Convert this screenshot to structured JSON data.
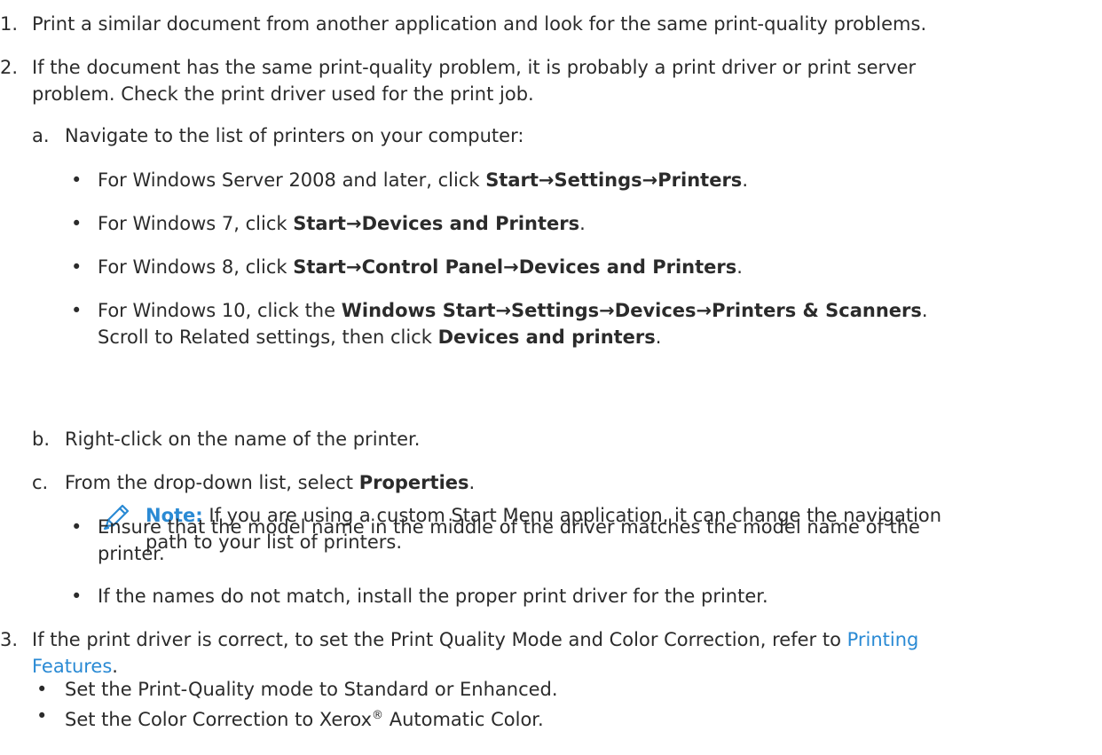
{
  "steps": [
    {
      "num": "1.",
      "text": "Print a similar document from another application and look for the same print-quality problems."
    },
    {
      "num": "2.",
      "line1": "If the document has the same print-quality problem, it is probably a print driver or print server",
      "line2": "problem. Check the print driver used for the print job."
    },
    {
      "num": "3.",
      "text_before": "If the print driver is correct, to set the Print Quality Mode and Color Correction, refer to ",
      "link_part1": "Printing",
      "link_part2": "Features",
      "text_after": "."
    }
  ],
  "substeps": {
    "a": {
      "label": "a.",
      "text": "Navigate to the list of printers on your computer:"
    },
    "b": {
      "label": "b.",
      "text": "Right-click on the name of the printer."
    },
    "c": {
      "label": "c.",
      "text_before": "From the drop-down list, select ",
      "bold": "Properties",
      "text_after": "."
    }
  },
  "os_items": {
    "server2008": {
      "prefix": "For Windows Server 2008 and later, click ",
      "b1": "Start",
      "arrow1": "→",
      "b2": "Settings",
      "arrow2": "→",
      "b3": "Printers",
      "suffix": "."
    },
    "win7": {
      "prefix": "For Windows 7, click ",
      "b1": "Start",
      "arrow1": "→",
      "b2": "Devices and Printers",
      "suffix": "."
    },
    "win8": {
      "prefix": "For Windows 8, click ",
      "b1": "Start",
      "arrow1": "→",
      "b2": "Control Panel",
      "arrow2": "→",
      "b3": "Devices and Printers",
      "suffix": "."
    },
    "win10": {
      "prefix": "For Windows 10, click the ",
      "b1": "Windows Start",
      "arrow1": "→",
      "b2": "Settings",
      "arrow2": "→",
      "b3": "Devices",
      "arrow3": "→",
      "b4": "Printers & Scanners",
      "suffix": ".",
      "line2_prefix": "Scroll to Related settings, then click ",
      "line2_bold": "Devices and printers",
      "line2_suffix": "."
    }
  },
  "note": {
    "label": "Note:",
    "line1": " If you are using a custom Start Menu application, it can change the navigation",
    "line2": "path to your list of printers.",
    "icon": "pencil-icon"
  },
  "properties_checks": {
    "model": {
      "line1": "Ensure that the model name in the middle of the driver matches the model name of the",
      "line2": "printer."
    },
    "names": {
      "text": "If the names do not match, install the proper print driver for the printer."
    }
  },
  "quality_settings": [
    {
      "text": "Set the Print-Quality mode to Standard or Enhanced."
    },
    {
      "text_before": "Set the Color Correction to Xerox",
      "reg": "®",
      "text_after": " Automatic Color."
    }
  ],
  "bullet": "•",
  "colors": {
    "text": "#2b2b2b",
    "accent": "#2a8ad4"
  }
}
